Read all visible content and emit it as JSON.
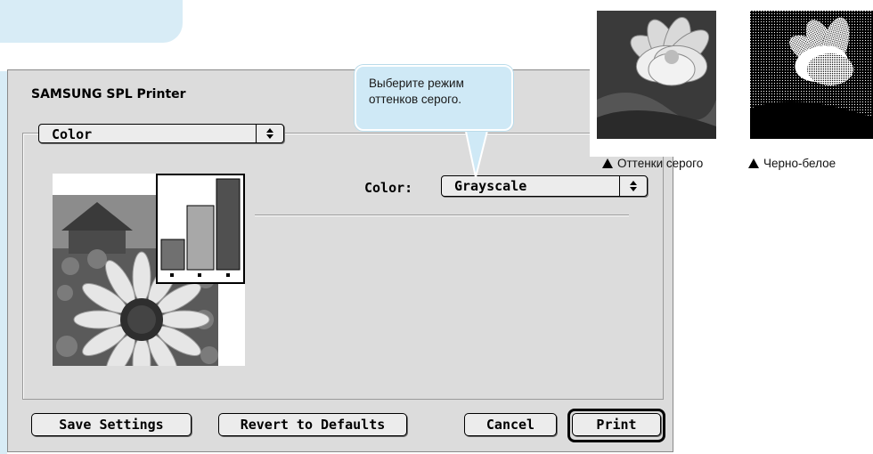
{
  "dialog": {
    "title": "SAMSUNG SPL Printer",
    "panel_popup": {
      "label": "Color"
    },
    "color": {
      "label": "Color:",
      "value": "Grayscale"
    },
    "buttons": {
      "save": "Save Settings",
      "revert": "Revert to Defaults",
      "cancel": "Cancel",
      "print": "Print"
    }
  },
  "callout": {
    "text": "Выберите режим\nоттенков серого."
  },
  "samples": [
    {
      "caption": "Оттенки серого"
    },
    {
      "caption": "Черно-белое"
    }
  ],
  "colors": {
    "accent": "#cfe9f6",
    "dialog_bg": "#dcdcdc",
    "page_accent": "#d8ecf6"
  },
  "icons": {
    "popup": "updown-arrows-icon",
    "caption_marker": "triangle-up-icon"
  }
}
